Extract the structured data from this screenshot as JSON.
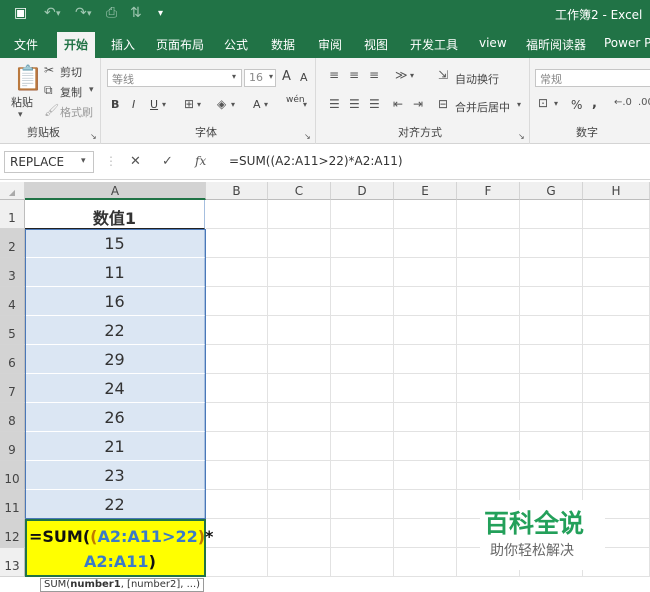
{
  "title_bar": {
    "title": "工作簿2  -  Excel",
    "save_icon": "save-icon",
    "undo_icon": "undo-icon",
    "redo_icon": "redo-icon"
  },
  "tabs": [
    {
      "label": "文件"
    },
    {
      "label": "开始"
    },
    {
      "label": "插入"
    },
    {
      "label": "页面布局"
    },
    {
      "label": "公式"
    },
    {
      "label": "数据"
    },
    {
      "label": "审阅"
    },
    {
      "label": "视图"
    },
    {
      "label": "开发工具"
    },
    {
      "label": "view"
    },
    {
      "label": "福昕阅读器"
    },
    {
      "label": "Power Pi"
    }
  ],
  "ribbon": {
    "clipboard": {
      "cut": "剪切",
      "copy": "复制",
      "format_painter": "格式刷",
      "paste": "粘贴",
      "group": "剪贴板"
    },
    "font": {
      "name": "等线",
      "size": "16",
      "grow": "A",
      "shrink": "A",
      "bold": "B",
      "italic": "I",
      "underline": "U",
      "font_color": "A",
      "wen": "wén",
      "group": "字体"
    },
    "alignment": {
      "wrap": "自动换行",
      "merge": "合并后居中",
      "group": "对齐方式"
    },
    "number": {
      "format": "常规",
      "percent": "%",
      "comma": ",",
      "group": "数字"
    }
  },
  "formula_bar": {
    "name_box": "REPLACE",
    "cancel": "✕",
    "confirm": "✓",
    "fx": "fx",
    "formula": "=SUM((A2:A11>22)*A2:A11)"
  },
  "sheet": {
    "columns": [
      "A",
      "B",
      "C",
      "D",
      "E",
      "F",
      "G",
      "H"
    ],
    "rows": [
      "1",
      "2",
      "3",
      "4",
      "5",
      "6",
      "7",
      "8",
      "9",
      "10",
      "11",
      "12",
      "13"
    ],
    "header_cell": "数值1",
    "values": [
      "15",
      "11",
      "16",
      "22",
      "29",
      "24",
      "26",
      "21",
      "23",
      "22"
    ],
    "edit_formula": {
      "p1": "=SUM(",
      "p2": "(",
      "p3": "A2:A11",
      "p4": ">22",
      "p5": ")",
      "p6": "*",
      "p7": "A2:A11",
      "p8": ")"
    },
    "tooltip": {
      "fn": "SUM(",
      "arg1": "number1",
      ",rest": "",
      "rest_text": ", [number2], ...)"
    }
  },
  "watermark": {
    "title": "百科全说",
    "subtitle": "助你轻松解决"
  }
}
